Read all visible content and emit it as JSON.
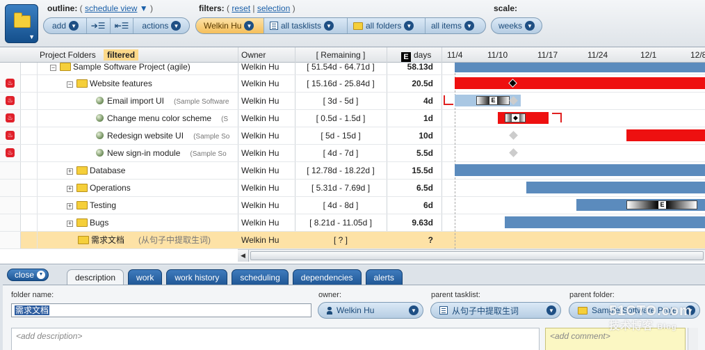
{
  "toolbar": {
    "outline_label": "outline:",
    "outline_link": "schedule view",
    "outline_caret": "▼",
    "filters_label": "filters:",
    "filters_reset": "reset",
    "filters_selection": "selection",
    "scale_label": "scale:",
    "add_label": "add",
    "actions_label": "actions",
    "filter_user": "Welkin Hu",
    "filter_tasklists": "all tasklists",
    "filter_folders": "all folders",
    "filter_items": "all items",
    "scale_value": "weeks"
  },
  "grid": {
    "col_project_folders": "Project Folders",
    "filtered_tag": "filtered",
    "col_owner": "Owner",
    "col_remaining": "[ Remaining ]",
    "col_days": "days",
    "days_badge": "E",
    "timeline_dates": [
      "11/4",
      "11/10",
      "11/17",
      "11/24",
      "12/1",
      "12/8"
    ],
    "rows": [
      {
        "name": "Sample Software Project (agile)",
        "sub": "",
        "owner": "Welkin Hu",
        "remaining": "[ 51.54d - 64.71d ]",
        "days": "58.13d"
      },
      {
        "name": "Website features",
        "sub": "",
        "owner": "Welkin Hu",
        "remaining": "[ 15.16d - 25.84d ]",
        "days": "20.5d"
      },
      {
        "name": "Email import UI",
        "sub": "(Sample Software",
        "owner": "Welkin Hu",
        "remaining": "[ 3d - 5d ]",
        "days": "4d"
      },
      {
        "name": "Change menu color scheme",
        "sub": "(S",
        "owner": "Welkin Hu",
        "remaining": "[ 0.5d - 1.5d ]",
        "days": "1d"
      },
      {
        "name": "Redesign website UI",
        "sub": "(Sample So",
        "owner": "Welkin Hu",
        "remaining": "[ 5d - 15d ]",
        "days": "10d"
      },
      {
        "name": "New sign-in module",
        "sub": "(Sample So",
        "owner": "Welkin Hu",
        "remaining": "[ 4d - 7d ]",
        "days": "5.5d"
      },
      {
        "name": "Database",
        "sub": "",
        "owner": "Welkin Hu",
        "remaining": "[ 12.78d - 18.22d ]",
        "days": "15.5d"
      },
      {
        "name": "Operations",
        "sub": "",
        "owner": "Welkin Hu",
        "remaining": "[ 5.31d - 7.69d ]",
        "days": "6.5d"
      },
      {
        "name": "Testing",
        "sub": "",
        "owner": "Welkin Hu",
        "remaining": "[ 4d - 8d ]",
        "days": "6d"
      },
      {
        "name": "Bugs",
        "sub": "",
        "owner": "Welkin Hu",
        "remaining": "[ 8.21d - 11.05d ]",
        "days": "9.63d"
      },
      {
        "name": "需求文档",
        "sub": "(从句子中提取生词)",
        "owner": "Welkin Hu",
        "remaining": "[ ? ]",
        "days": "?"
      }
    ]
  },
  "bottom": {
    "close_label": "close",
    "tabs": [
      "description",
      "work",
      "work history",
      "scheduling",
      "dependencies",
      "alerts"
    ],
    "folder_name_label": "folder name:",
    "folder_name_value": "需求文档",
    "owner_label": "owner:",
    "owner_value": "Welkin Hu",
    "parent_tasklist_label": "parent tasklist:",
    "parent_tasklist_value": "从句子中提取生词",
    "parent_folder_label": "parent folder:",
    "parent_folder_value": "Sample Software Proje",
    "description_placeholder": "<add description>",
    "comment_placeholder": "<add comment>"
  },
  "watermark": {
    "line1": "51CTO.com",
    "line2": "技术博客",
    "line3": "Blog"
  },
  "colors": {
    "accent_blue": "#1e4f84",
    "bar_blue": "#5b8bbd",
    "bar_red": "#ee1010",
    "selected_row": "#fde2a6"
  }
}
